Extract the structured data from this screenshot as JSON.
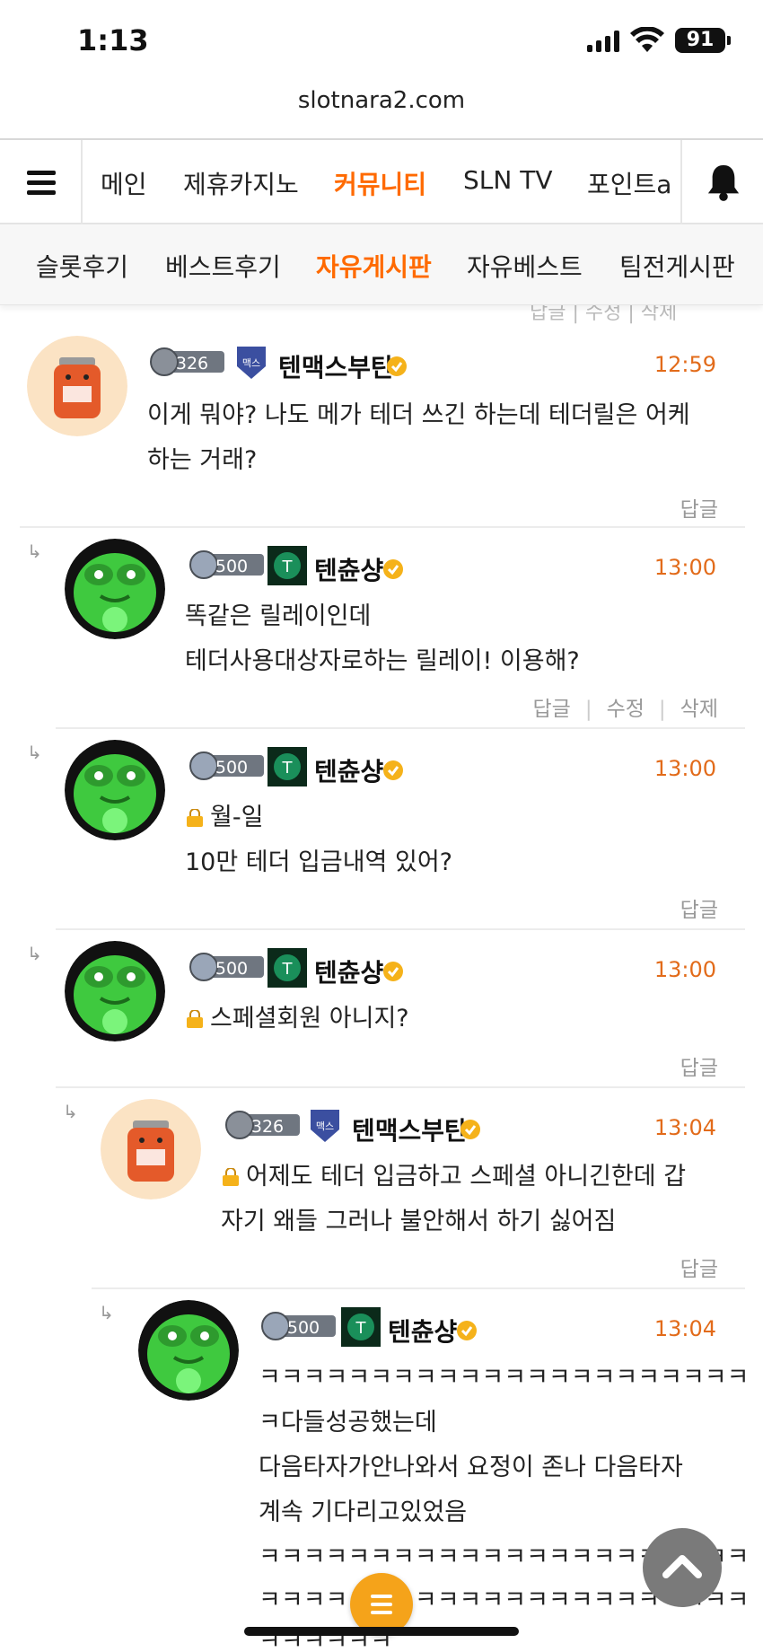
{
  "status_bar": {
    "time": "1:13",
    "battery": "91"
  },
  "browser": {
    "url": "slotnara2.com"
  },
  "main_nav": {
    "items": [
      {
        "label": "메인",
        "active": false
      },
      {
        "label": "제휴카지노",
        "active": false
      },
      {
        "label": "커뮤니티",
        "active": true
      },
      {
        "label": "SLN TV",
        "active": false
      },
      {
        "label": "포인트a",
        "active": false
      }
    ]
  },
  "sub_nav": {
    "items": [
      {
        "label": "슬롯후기",
        "active": false
      },
      {
        "label": "베스트후기",
        "active": false
      },
      {
        "label": "자유게시판",
        "active": true
      },
      {
        "label": "자유베스트",
        "active": false
      },
      {
        "label": "팀전게시판",
        "active": false
      }
    ]
  },
  "colors": {
    "accent": "#ff6a00",
    "time": "#e26b1a",
    "fab": "#f5a31a"
  },
  "comments": [
    {
      "author": "텐맥스부탄",
      "level": "326",
      "time": "12:59",
      "lines": [
        "이게 뭐야? 나도 메가 테더 쓰긴 하는데 테더릴은 어케",
        "하는 거래?"
      ],
      "actions": [
        "답글"
      ],
      "avatar": "max-butane-icon"
    },
    {
      "author": "텐츈샹",
      "level": "500",
      "time": "13:00",
      "lines": [
        "똑같은 릴레이인데",
        "테더사용대상자로하는 릴레이! 이용해?"
      ],
      "actions": [
        "답글",
        "수정",
        "삭제"
      ],
      "avatar": "frog-icon"
    },
    {
      "author": "텐츈샹",
      "level": "500",
      "time": "13:00",
      "lines": [
        "월-일",
        "10만 테더 입금내역 있어?"
      ],
      "actions": [
        "답글"
      ],
      "avatar": "frog-icon"
    },
    {
      "author": "텐츈샹",
      "level": "500",
      "time": "13:00",
      "lines": [
        "스페셜회원 아니지?"
      ],
      "actions": [
        "답글"
      ],
      "avatar": "frog-icon"
    },
    {
      "author": "텐맥스부탄",
      "level": "326",
      "time": "13:04",
      "lines": [
        "어제도 테더 입금하고 스페셜 아니긴한데 갑",
        "자기 왜들 그러나 불안해서 하기 싫어짐"
      ],
      "actions": [
        "답글"
      ],
      "avatar": "max-butane-icon"
    },
    {
      "author": "텐츈샹",
      "level": "500",
      "time": "13:04",
      "lines": [
        "ㅋㅋㅋㅋㅋㅋㅋㅋㅋㅋㅋㅋㅋㅋㅋㅋㅋㅋㅋㅋㅋㅋ",
        "ㅋ다들성공했는데",
        "다음타자가안나와서 요정이 존나 다음타자",
        "계속 기다리고있었음",
        "ㅋㅋㅋㅋㅋㅋㅋㅋㅋㅋㅋㅋㅋㅋㅋㅋㅋㅋㅋㅋㅋㅋ",
        "ㅋㅋㅋㅋㅋㅋㅋㅋㅋㅋㅋㅋㅋㅋㅋㅋㅋㅋㅋㅋㅋㅋ",
        "ㅋㅋㅋㅋㅋㅋ"
      ],
      "actions": [],
      "avatar": "frog-icon"
    }
  ],
  "ghost_actions": "답글 | 수정 | 삭제",
  "badge_text": {
    "team_max": "맥스",
    "team_t": "T"
  }
}
